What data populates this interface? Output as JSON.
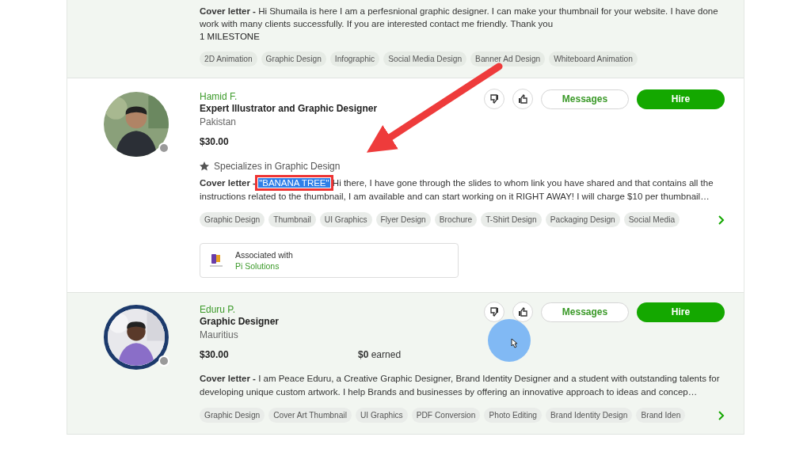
{
  "freelancers": [
    {
      "highlighted": true,
      "cover_letter": {
        "label": "Cover letter -",
        "text": "Hi Shumaila is here I am a perfesnional graphic designer. I can make your thumbnail for your website. I have done work with many clients successfully. If you are interested contact me friendly. Thank you"
      },
      "milestone": "1 MILESTONE",
      "skills": [
        "2D Animation",
        "Graphic Design",
        "Infographic",
        "Social Media Design",
        "Banner Ad Design",
        "Whiteboard Animation"
      ]
    },
    {
      "highlighted": false,
      "name": "Hamid F.",
      "title": "Expert Illustrator and Graphic Designer",
      "country": "Pakistan",
      "online": false,
      "avatar_ring": false,
      "rate": "$30.00",
      "specialty": "Specializes in Graphic Design",
      "actions": {
        "messages": "Messages",
        "hire": "Hire"
      },
      "cover_letter": {
        "label": "Cover letter -",
        "highlight": "\"BANANA TREE\"",
        "text": "Hi there, I have gone through the slides to whom link you have shared and that contains all the instructions related to the thumbnail, I am available and can start working on it RIGHT AWAY! I will charge $10 per thumbnail…"
      },
      "skills": [
        "Graphic Design",
        "Thumbnail",
        "UI Graphics",
        "Flyer Design",
        "Brochure",
        "T-Shirt Design",
        "Packaging Design",
        "Social Media"
      ],
      "association": {
        "label": "Associated with",
        "company": "Pi Solutions"
      }
    },
    {
      "highlighted": true,
      "name": "Eduru P.",
      "title": "Graphic Designer",
      "country": "Mauritius",
      "online": false,
      "avatar_ring": true,
      "rate": "$30.00",
      "earned": {
        "amount": "$0",
        "label": "earned"
      },
      "actions": {
        "messages": "Messages",
        "hire": "Hire"
      },
      "cover_letter": {
        "label": "Cover letter -",
        "text": "I am Peace Eduru, a Creative Graphic Designer, Brand Identity Designer and a student with outstanding talents for developing unique custom artwork. I help Brands and businesses by offering an innovative approach to ideas and concep…"
      },
      "skills": [
        "Graphic Design",
        "Cover Art Thumbnail",
        "UI Graphics",
        "PDF Conversion",
        "Photo Editing",
        "Brand Identity Design",
        "Brand Iden"
      ]
    }
  ]
}
